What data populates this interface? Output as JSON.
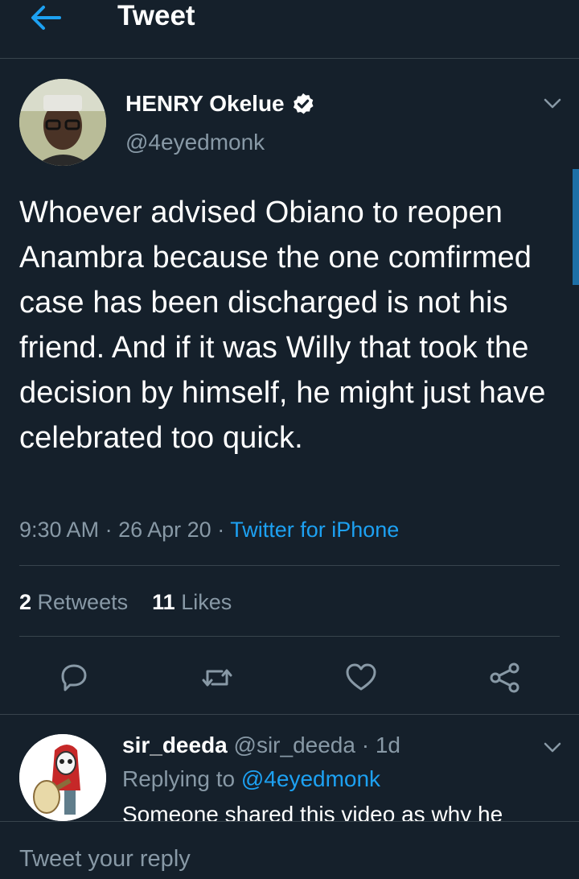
{
  "header": {
    "title": "Tweet",
    "back_icon": "arrow-left-icon"
  },
  "tweet": {
    "author_name": "HENRY Okelue",
    "author_handle": "@4eyedmonk",
    "verified_icon": "verified-badge-icon",
    "text": "Whoever advised Obiano to reopen Anambra because the one comfirmed case has been discharged is not his friend. And if it was Willy that took the decision by himself, he might just have celebrated too quick.",
    "time": "9:30 AM",
    "date": "26 Apr 20",
    "separator": "·",
    "source": "Twitter for iPhone",
    "retweets_count": "2",
    "retweets_label": "Retweets",
    "likes_count": "11",
    "likes_label": "Likes",
    "actions": [
      "reply-icon",
      "retweet-icon",
      "like-icon",
      "share-icon"
    ]
  },
  "reply": {
    "author_name": "sir_deeda",
    "author_handle": "@sir_deeda",
    "separator": "·",
    "age": "1d",
    "replying_prefix": "Replying to",
    "replying_to": "@4eyedmonk",
    "text": "Someone shared this video as why he"
  },
  "compose": {
    "placeholder": "Tweet your reply"
  },
  "colors": {
    "background": "#15202b",
    "accent": "#1da1f2",
    "muted": "#8899a6",
    "divider": "#38444d"
  }
}
